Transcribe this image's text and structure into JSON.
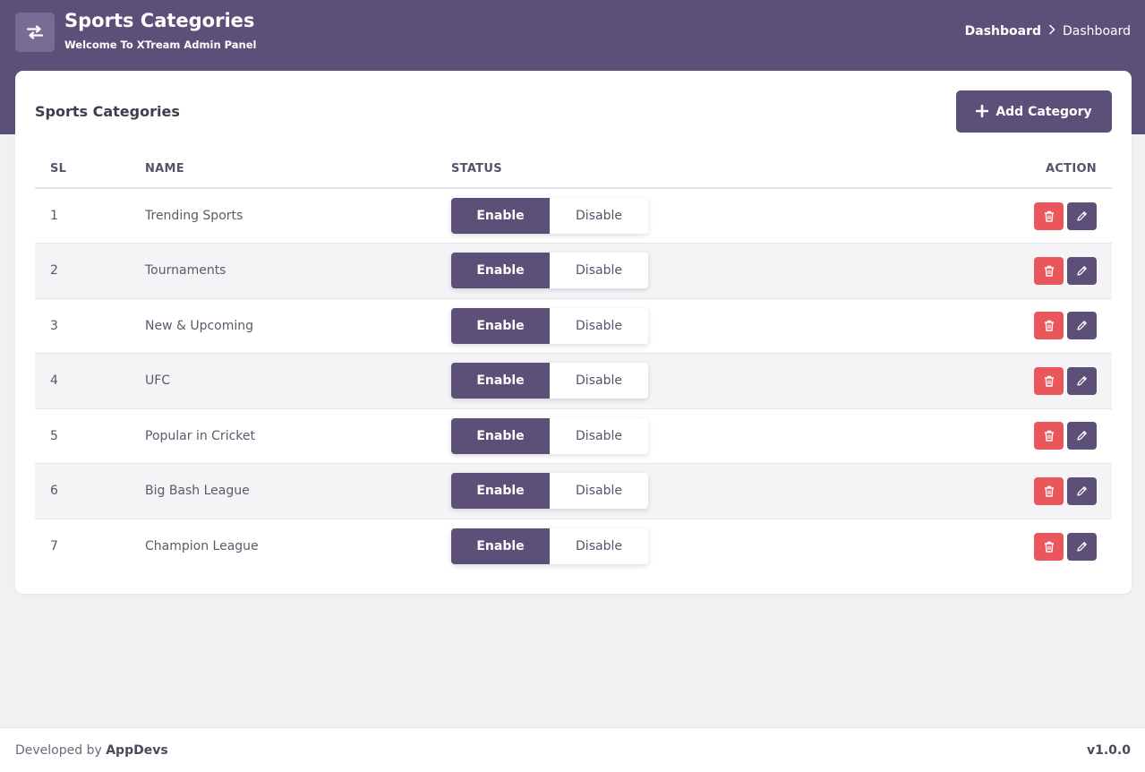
{
  "header": {
    "title": "Sports Categories",
    "subtitle": "Welcome To XTream Admin Panel",
    "icon": "swap-arrows-icon",
    "breadcrumb": [
      "Dashboard",
      "Dashboard"
    ]
  },
  "card": {
    "title": "Sports Categories",
    "add_button_label": "Add Category"
  },
  "table": {
    "columns": [
      "SL",
      "NAME",
      "STATUS",
      "ACTION"
    ],
    "toggle_labels": {
      "enable": "Enable",
      "disable": "Disable"
    },
    "rows": [
      {
        "sl": "1",
        "name": "Trending Sports",
        "status": "Enable"
      },
      {
        "sl": "2",
        "name": "Tournaments",
        "status": "Enable"
      },
      {
        "sl": "3",
        "name": "New & Upcoming",
        "status": "Enable"
      },
      {
        "sl": "4",
        "name": "UFC",
        "status": "Enable"
      },
      {
        "sl": "5",
        "name": "Popular in Cricket",
        "status": "Enable"
      },
      {
        "sl": "6",
        "name": "Big Bash League",
        "status": "Enable"
      },
      {
        "sl": "7",
        "name": "Champion League",
        "status": "Enable"
      }
    ]
  },
  "footer": {
    "prefix": "Developed by",
    "brand": "AppDevs",
    "version": "v1.0.0"
  },
  "colors": {
    "primary": "#5c5078",
    "danger": "#e9575d",
    "background": "#f1f0f2"
  }
}
